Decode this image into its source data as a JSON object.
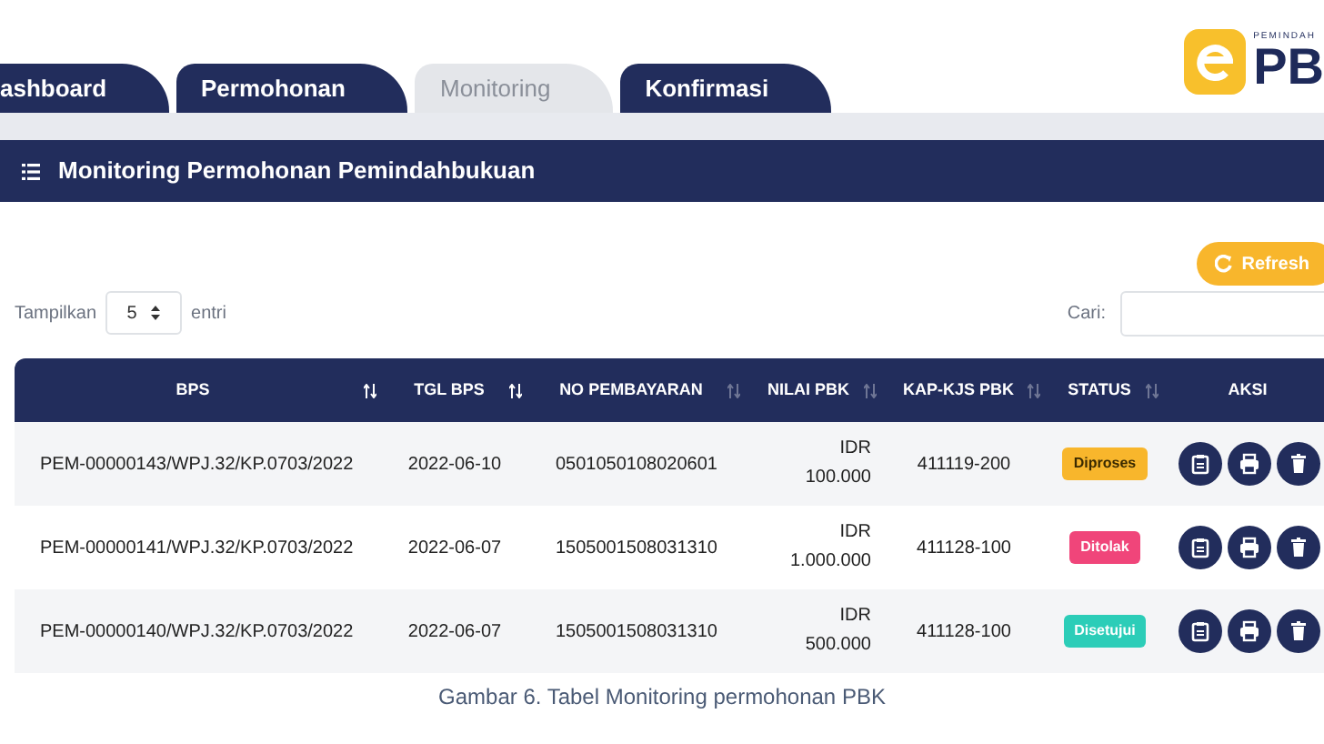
{
  "tabs": [
    {
      "label": "ashboard",
      "selected": false
    },
    {
      "label": "Permohonan",
      "selected": false
    },
    {
      "label": "Monitoring",
      "selected": true
    },
    {
      "label": "Konfirmasi",
      "selected": false
    }
  ],
  "logo": {
    "caption": "PEMINDAH",
    "text": "PB"
  },
  "panel_title": "Monitoring Permohonan Pemindahbukuan",
  "refresh_button": "Refresh",
  "length_control": {
    "prefix": "Tampilkan",
    "value": "5",
    "suffix": "entri"
  },
  "search": {
    "label": "Cari:"
  },
  "table": {
    "columns": [
      "BPS",
      "TGL BPS",
      "NO PEMBAYARAN",
      "NILAI PBK",
      "KAP-KJS PBK",
      "STATUS",
      "AKSI"
    ],
    "rows": [
      {
        "bps": "PEM-00000143/WPJ.32/KP.0703/2022",
        "tgl": "2022-06-10",
        "no": "0501050108020601",
        "nilai": [
          "IDR",
          "100.000"
        ],
        "kap": "411119-200",
        "status": {
          "label": "Diproses",
          "kind": "processing"
        }
      },
      {
        "bps": "PEM-00000141/WPJ.32/KP.0703/2022",
        "tgl": "2022-06-07",
        "no": "1505001508031310",
        "nilai": [
          "IDR",
          "1.000.000"
        ],
        "kap": "411128-100",
        "status": {
          "label": "Ditolak",
          "kind": "rejected"
        }
      },
      {
        "bps": "PEM-00000140/WPJ.32/KP.0703/2022",
        "tgl": "2022-06-07",
        "no": "1505001508031310",
        "nilai": [
          "IDR",
          "500.000"
        ],
        "kap": "411128-100",
        "status": {
          "label": "Disetujui",
          "kind": "approved"
        }
      }
    ]
  },
  "caption": "Gambar 6. Tabel Monitoring permohonan PBK"
}
